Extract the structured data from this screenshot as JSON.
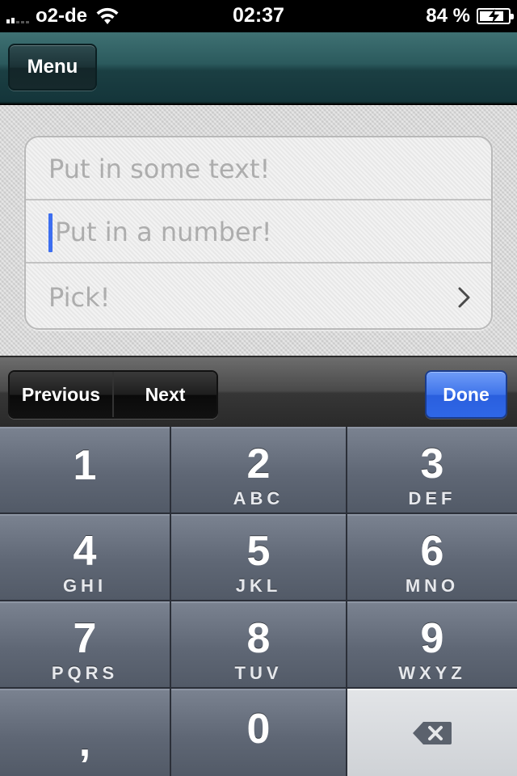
{
  "status_bar": {
    "carrier": "o2-de",
    "time": "02:37",
    "battery_percent": "84 %",
    "battery_level": 0.84,
    "signal_bars": 2,
    "icons": [
      "signal-icon",
      "wifi-icon",
      "battery-charging-icon"
    ]
  },
  "nav_bar": {
    "menu_label": "Menu"
  },
  "form": {
    "text_field": {
      "value": "",
      "placeholder": "Put in some text!"
    },
    "number_field": {
      "value": "",
      "placeholder": "Put in a number!",
      "focused": true
    },
    "picker": {
      "label": "Pick!",
      "icon": "chevron-right-icon"
    }
  },
  "toolbar": {
    "previous_label": "Previous",
    "next_label": "Next",
    "done_label": "Done"
  },
  "keypad": {
    "keys": [
      {
        "digit": "1",
        "letters": ""
      },
      {
        "digit": "2",
        "letters": "ABC"
      },
      {
        "digit": "3",
        "letters": "DEF"
      },
      {
        "digit": "4",
        "letters": "GHI"
      },
      {
        "digit": "5",
        "letters": "JKL"
      },
      {
        "digit": "6",
        "letters": "MNO"
      },
      {
        "digit": "7",
        "letters": "PQRS"
      },
      {
        "digit": "8",
        "letters": "TUV"
      },
      {
        "digit": "9",
        "letters": "WXYZ"
      },
      {
        "digit": ",",
        "letters": ""
      },
      {
        "digit": "0",
        "letters": ""
      }
    ],
    "delete_icon": "backspace-icon"
  },
  "colors": {
    "nav_accent": "#2b5a5d",
    "done_blue": "#2f67e6",
    "caret_blue": "#3d6ef0",
    "keypad_key": "#5f6775"
  }
}
